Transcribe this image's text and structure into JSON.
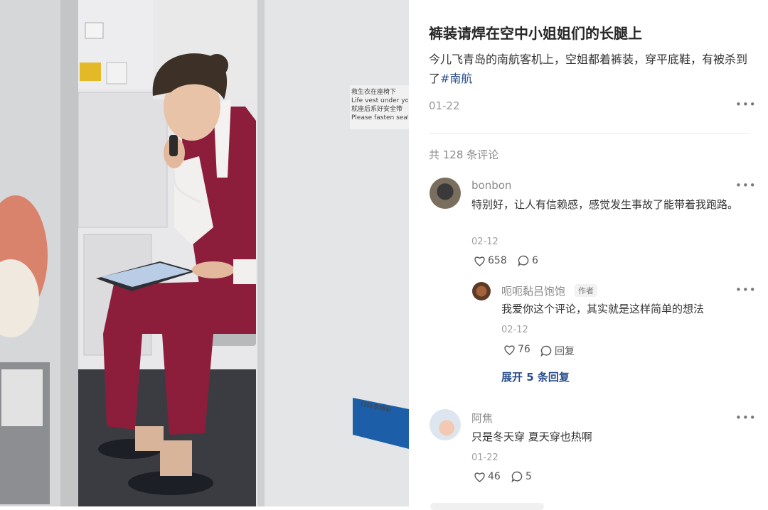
{
  "photo": {
    "sign_lifevest": [
      "救生衣在座椅下",
      "Life vest under your s",
      "就座后系好安全带",
      "Please fasten seat belt"
    ],
    "sign_blue": "扫码享精彩"
  },
  "post": {
    "title": "裤装请焊在空中小姐姐们的长腿上",
    "body": "今儿飞青岛的南航客机上，空姐都着裤装，穿平底鞋，有被杀到了",
    "hashtag": "#南航",
    "date": "01-22",
    "more_icon": "more-dots-icon"
  },
  "comments_header": {
    "count_text": "共 128 条评论"
  },
  "comments": [
    {
      "user": "bonbon",
      "text": "特别好，让人有信赖感，感觉发生事故了能带着我跑路。",
      "date": "02-12",
      "likes": "658",
      "replies": "6"
    },
    {
      "user": "阿焦",
      "text": "只是冬天穿 夏天穿也热啊",
      "date": "01-22",
      "likes": "46",
      "replies": "5"
    }
  ],
  "reply": {
    "user": "呃呃黏吕饱饱",
    "badge": "作者",
    "text": "我爱你这个评论，其实就是这样简单的想法",
    "date": "02-12",
    "likes": "76",
    "reply_label": "回复"
  },
  "expand_label": "展开 5 条回复",
  "colors": {
    "hashtag": "#284c8c",
    "uniform": "#8c1e3c",
    "text_secondary": "#8a8a8a"
  }
}
